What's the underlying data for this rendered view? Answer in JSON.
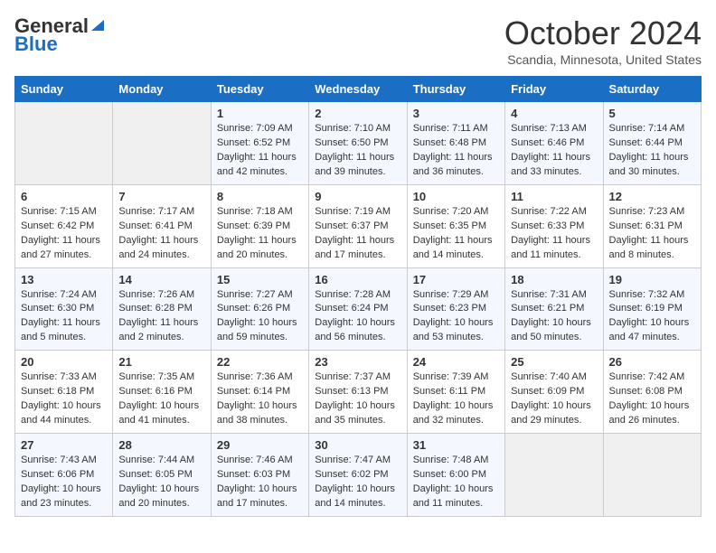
{
  "header": {
    "logo_line1": "General",
    "logo_line2": "Blue",
    "month_title": "October 2024",
    "location": "Scandia, Minnesota, United States"
  },
  "days_of_week": [
    "Sunday",
    "Monday",
    "Tuesday",
    "Wednesday",
    "Thursday",
    "Friday",
    "Saturday"
  ],
  "weeks": [
    [
      {
        "day": "",
        "content": ""
      },
      {
        "day": "",
        "content": ""
      },
      {
        "day": "1",
        "content": "Sunrise: 7:09 AM\nSunset: 6:52 PM\nDaylight: 11 hours and 42 minutes."
      },
      {
        "day": "2",
        "content": "Sunrise: 7:10 AM\nSunset: 6:50 PM\nDaylight: 11 hours and 39 minutes."
      },
      {
        "day": "3",
        "content": "Sunrise: 7:11 AM\nSunset: 6:48 PM\nDaylight: 11 hours and 36 minutes."
      },
      {
        "day": "4",
        "content": "Sunrise: 7:13 AM\nSunset: 6:46 PM\nDaylight: 11 hours and 33 minutes."
      },
      {
        "day": "5",
        "content": "Sunrise: 7:14 AM\nSunset: 6:44 PM\nDaylight: 11 hours and 30 minutes."
      }
    ],
    [
      {
        "day": "6",
        "content": "Sunrise: 7:15 AM\nSunset: 6:42 PM\nDaylight: 11 hours and 27 minutes."
      },
      {
        "day": "7",
        "content": "Sunrise: 7:17 AM\nSunset: 6:41 PM\nDaylight: 11 hours and 24 minutes."
      },
      {
        "day": "8",
        "content": "Sunrise: 7:18 AM\nSunset: 6:39 PM\nDaylight: 11 hours and 20 minutes."
      },
      {
        "day": "9",
        "content": "Sunrise: 7:19 AM\nSunset: 6:37 PM\nDaylight: 11 hours and 17 minutes."
      },
      {
        "day": "10",
        "content": "Sunrise: 7:20 AM\nSunset: 6:35 PM\nDaylight: 11 hours and 14 minutes."
      },
      {
        "day": "11",
        "content": "Sunrise: 7:22 AM\nSunset: 6:33 PM\nDaylight: 11 hours and 11 minutes."
      },
      {
        "day": "12",
        "content": "Sunrise: 7:23 AM\nSunset: 6:31 PM\nDaylight: 11 hours and 8 minutes."
      }
    ],
    [
      {
        "day": "13",
        "content": "Sunrise: 7:24 AM\nSunset: 6:30 PM\nDaylight: 11 hours and 5 minutes."
      },
      {
        "day": "14",
        "content": "Sunrise: 7:26 AM\nSunset: 6:28 PM\nDaylight: 11 hours and 2 minutes."
      },
      {
        "day": "15",
        "content": "Sunrise: 7:27 AM\nSunset: 6:26 PM\nDaylight: 10 hours and 59 minutes."
      },
      {
        "day": "16",
        "content": "Sunrise: 7:28 AM\nSunset: 6:24 PM\nDaylight: 10 hours and 56 minutes."
      },
      {
        "day": "17",
        "content": "Sunrise: 7:29 AM\nSunset: 6:23 PM\nDaylight: 10 hours and 53 minutes."
      },
      {
        "day": "18",
        "content": "Sunrise: 7:31 AM\nSunset: 6:21 PM\nDaylight: 10 hours and 50 minutes."
      },
      {
        "day": "19",
        "content": "Sunrise: 7:32 AM\nSunset: 6:19 PM\nDaylight: 10 hours and 47 minutes."
      }
    ],
    [
      {
        "day": "20",
        "content": "Sunrise: 7:33 AM\nSunset: 6:18 PM\nDaylight: 10 hours and 44 minutes."
      },
      {
        "day": "21",
        "content": "Sunrise: 7:35 AM\nSunset: 6:16 PM\nDaylight: 10 hours and 41 minutes."
      },
      {
        "day": "22",
        "content": "Sunrise: 7:36 AM\nSunset: 6:14 PM\nDaylight: 10 hours and 38 minutes."
      },
      {
        "day": "23",
        "content": "Sunrise: 7:37 AM\nSunset: 6:13 PM\nDaylight: 10 hours and 35 minutes."
      },
      {
        "day": "24",
        "content": "Sunrise: 7:39 AM\nSunset: 6:11 PM\nDaylight: 10 hours and 32 minutes."
      },
      {
        "day": "25",
        "content": "Sunrise: 7:40 AM\nSunset: 6:09 PM\nDaylight: 10 hours and 29 minutes."
      },
      {
        "day": "26",
        "content": "Sunrise: 7:42 AM\nSunset: 6:08 PM\nDaylight: 10 hours and 26 minutes."
      }
    ],
    [
      {
        "day": "27",
        "content": "Sunrise: 7:43 AM\nSunset: 6:06 PM\nDaylight: 10 hours and 23 minutes."
      },
      {
        "day": "28",
        "content": "Sunrise: 7:44 AM\nSunset: 6:05 PM\nDaylight: 10 hours and 20 minutes."
      },
      {
        "day": "29",
        "content": "Sunrise: 7:46 AM\nSunset: 6:03 PM\nDaylight: 10 hours and 17 minutes."
      },
      {
        "day": "30",
        "content": "Sunrise: 7:47 AM\nSunset: 6:02 PM\nDaylight: 10 hours and 14 minutes."
      },
      {
        "day": "31",
        "content": "Sunrise: 7:48 AM\nSunset: 6:00 PM\nDaylight: 10 hours and 11 minutes."
      },
      {
        "day": "",
        "content": ""
      },
      {
        "day": "",
        "content": ""
      }
    ]
  ]
}
